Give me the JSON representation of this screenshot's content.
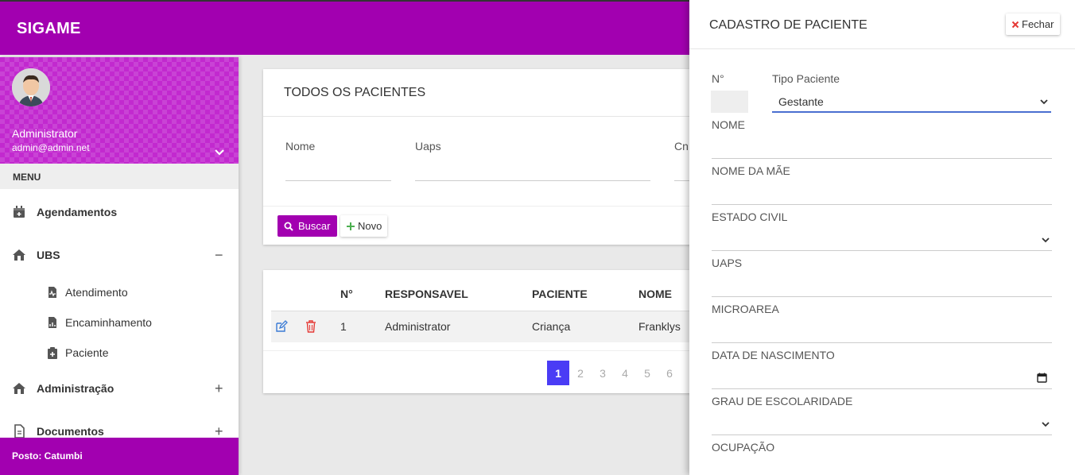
{
  "app": {
    "brand": "SIGAME"
  },
  "sidebar": {
    "user": {
      "name": "Administrator",
      "email": "admin@admin.net"
    },
    "menu_header": "MENU",
    "items": [
      {
        "label": "Agendamentos",
        "icon": "calendar-plus-icon"
      },
      {
        "label": "UBS",
        "icon": "home-icon",
        "toggle": "−"
      },
      {
        "label": "Administração",
        "icon": "home-icon",
        "toggle": "+"
      },
      {
        "label": "Documentos",
        "icon": "file-icon",
        "toggle": "+"
      }
    ],
    "subitems": [
      {
        "label": "Atendimento",
        "icon": "file-medical-icon"
      },
      {
        "label": "Encaminhamento",
        "icon": "file-chart-icon"
      },
      {
        "label": "Paciente",
        "icon": "clipboard-plus-icon"
      }
    ],
    "footer": "Posto: Catumbi"
  },
  "search_card": {
    "title": "TODOS OS PACIENTES",
    "fields": [
      "Nome",
      "Uaps",
      "Cn"
    ],
    "buscar_label": "Buscar",
    "novo_label": "Novo"
  },
  "table": {
    "headers": [
      "N°",
      "RESPONSAVEL",
      "PACIENTE",
      "NOME"
    ],
    "rows": [
      {
        "n": "1",
        "responsavel": "Administrator",
        "paciente": "Criança",
        "nome": "Franklys"
      }
    ],
    "pages": [
      "1",
      "2",
      "3",
      "4",
      "5",
      "6"
    ],
    "current_page": "1"
  },
  "panel": {
    "title": "CADASTRO DE PACIENTE",
    "close_label": "Fechar",
    "n_label": "N°",
    "tipo_label": "Tipo Paciente",
    "tipo_value": "Gestante",
    "fields": [
      "NOME",
      "NOME DA MÃE",
      "ESTADO CIVIL",
      "UAPS",
      "MICROAREA",
      "DATA DE NASCIMENTO",
      "GRAU DE ESCOLARIDADE",
      "OCUPAÇÃO"
    ]
  },
  "colors": {
    "brand": "#a200b0",
    "page_active": "#4a3cf5",
    "edit": "#3a7bd5",
    "delete": "#e53935"
  }
}
